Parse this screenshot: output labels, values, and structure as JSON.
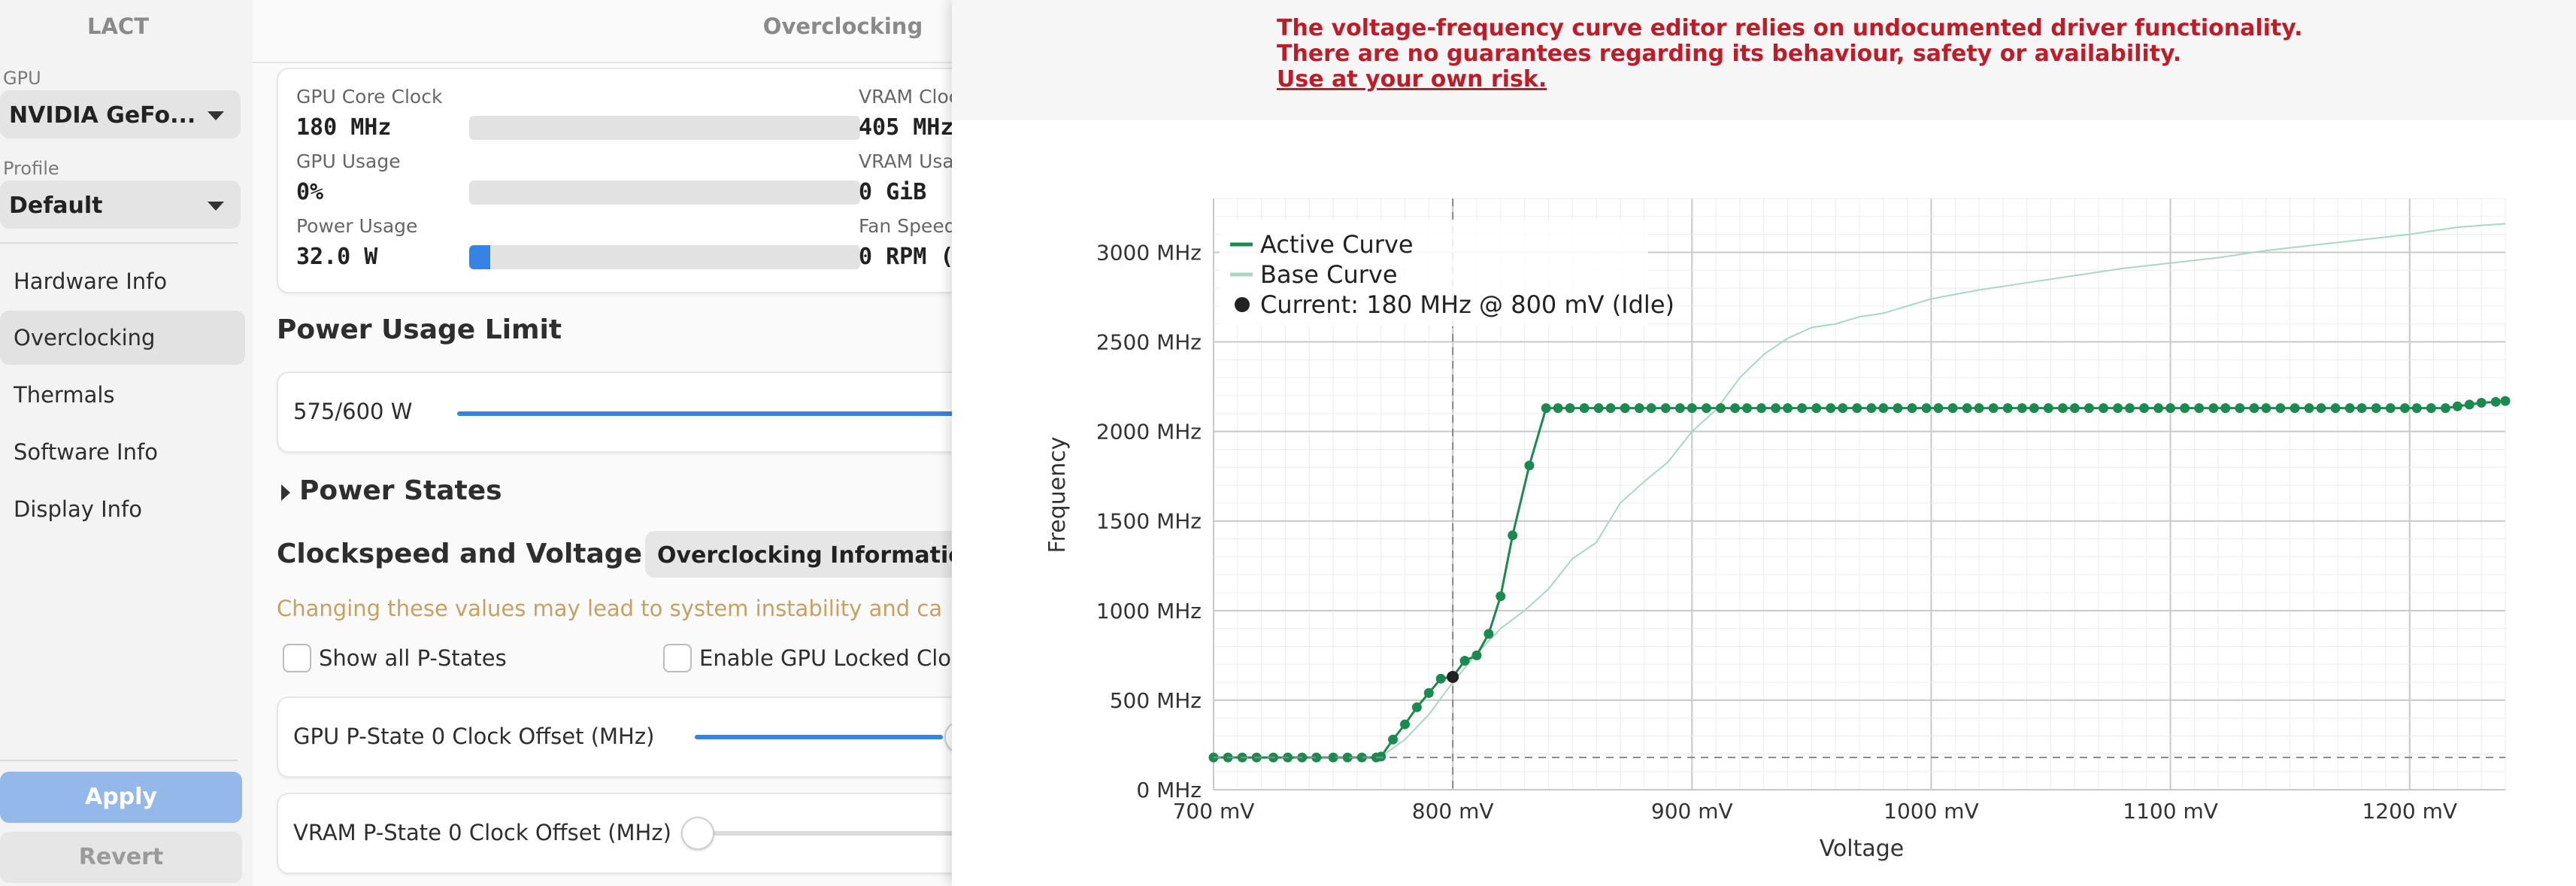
{
  "app": {
    "title": "LACT"
  },
  "sidebar": {
    "gpu_label": "GPU",
    "gpu_value": "NVIDIA GeFo...",
    "profile_label": "Profile",
    "profile_value": "Default",
    "items": [
      {
        "label": "Hardware Info"
      },
      {
        "label": "Overclocking",
        "active": true
      },
      {
        "label": "Thermals"
      },
      {
        "label": "Software Info"
      },
      {
        "label": "Display Info"
      }
    ],
    "apply_label": "Apply",
    "revert_label": "Revert"
  },
  "header": {
    "title": "Overclocking"
  },
  "stats": {
    "gpu_core_clock": {
      "label": "GPU Core Clock",
      "value": "180 MHz",
      "fill": 0.0
    },
    "gpu_usage": {
      "label": "GPU Usage",
      "value": "0%",
      "fill": 0.0
    },
    "power_usage": {
      "label": "Power Usage",
      "value": "32.0 W",
      "fill": 0.053
    },
    "vram_clock": {
      "label": "VRAM Cloc",
      "value": "405 MHz"
    },
    "vram_usage": {
      "label": "VRAM Usa",
      "value": "0 GiB"
    },
    "fan_speed": {
      "label": "Fan Speed",
      "value": "0 RPM ("
    }
  },
  "power_limit": {
    "title": "Power Usage Limit",
    "value": "575/600 W",
    "fraction": 0.958
  },
  "power_states": {
    "title": "Power States"
  },
  "clockspeed": {
    "title": "Clockspeed and Voltage",
    "info_button": "Overclocking Informatio",
    "warning": "Changing these values may lead to system instability and ca",
    "show_all_pstates": "Show all P-States",
    "enable_locked": "Enable GPU Locked Clo",
    "gpu_offset_label": "GPU P-State 0 Clock Offset (MHz)",
    "vram_offset_label": "VRAM P-State 0 Clock Offset (MHz)"
  },
  "vf_editor": {
    "warning_lines": [
      "The voltage-frequency curve editor relies on undocumented driver functionality.",
      "There are no guarantees regarding its behaviour, safety or availability.",
      "Use at your own risk."
    ]
  },
  "chart_data": {
    "type": "line",
    "xlabel": "Voltage",
    "ylabel": "Frequency",
    "xlim": [
      700,
      1240
    ],
    "ylim": [
      0,
      3300
    ],
    "x_ticks": [
      "700 mV",
      "800 mV",
      "900 mV",
      "1000 mV",
      "1100 mV",
      "1200 mV"
    ],
    "y_ticks": [
      "0 MHz",
      "500 MHz",
      "1000 MHz",
      "1500 MHz",
      "2000 MHz",
      "2500 MHz",
      "3000 MHz"
    ],
    "grid": true,
    "legend_position": "top-left",
    "current_point": {
      "x": 800,
      "y": 180,
      "label": "Current: 180 MHz @ 800 mV (Idle)"
    },
    "current_marker_y": 630,
    "colors": {
      "active": "#1b8a4e",
      "base": "#a8d8c0",
      "current": "#222222",
      "grid": "#d6d6d6",
      "dash": "#888888"
    },
    "series": [
      {
        "name": "Active Curve",
        "points": [
          [
            700,
            180
          ],
          [
            706,
            180
          ],
          [
            712,
            180
          ],
          [
            718,
            180
          ],
          [
            725,
            180
          ],
          [
            731,
            180
          ],
          [
            737,
            180
          ],
          [
            743,
            180
          ],
          [
            750,
            180
          ],
          [
            756,
            180
          ],
          [
            762,
            180
          ],
          [
            768,
            180
          ],
          [
            770,
            185
          ],
          [
            775,
            280
          ],
          [
            780,
            365
          ],
          [
            785,
            460
          ],
          [
            790,
            540
          ],
          [
            795,
            620
          ],
          [
            800,
            630
          ],
          [
            805,
            720
          ],
          [
            810,
            750
          ],
          [
            815,
            870
          ],
          [
            820,
            1080
          ],
          [
            825,
            1420
          ],
          [
            832,
            1810
          ],
          [
            839,
            2130
          ],
          [
            844,
            2130
          ],
          [
            849,
            2130
          ],
          [
            855,
            2130
          ],
          [
            861,
            2130
          ],
          [
            866,
            2130
          ],
          [
            872,
            2130
          ],
          [
            878,
            2130
          ],
          [
            883,
            2130
          ],
          [
            889,
            2130
          ],
          [
            895,
            2130
          ],
          [
            900,
            2130
          ],
          [
            906,
            2130
          ],
          [
            912,
            2130
          ],
          [
            918,
            2130
          ],
          [
            923,
            2130
          ],
          [
            929,
            2130
          ],
          [
            935,
            2130
          ],
          [
            940,
            2130
          ],
          [
            946,
            2130
          ],
          [
            952,
            2130
          ],
          [
            958,
            2130
          ],
          [
            963,
            2130
          ],
          [
            969,
            2130
          ],
          [
            975,
            2130
          ],
          [
            980,
            2130
          ],
          [
            986,
            2130
          ],
          [
            992,
            2130
          ],
          [
            998,
            2130
          ],
          [
            1003,
            2130
          ],
          [
            1009,
            2130
          ],
          [
            1015,
            2130
          ],
          [
            1020,
            2130
          ],
          [
            1026,
            2130
          ],
          [
            1032,
            2130
          ],
          [
            1038,
            2130
          ],
          [
            1043,
            2130
          ],
          [
            1049,
            2130
          ],
          [
            1055,
            2130
          ],
          [
            1060,
            2130
          ],
          [
            1066,
            2130
          ],
          [
            1072,
            2130
          ],
          [
            1078,
            2130
          ],
          [
            1083,
            2130
          ],
          [
            1089,
            2130
          ],
          [
            1095,
            2130
          ],
          [
            1100,
            2130
          ],
          [
            1106,
            2130
          ],
          [
            1112,
            2130
          ],
          [
            1118,
            2130
          ],
          [
            1123,
            2130
          ],
          [
            1129,
            2130
          ],
          [
            1135,
            2130
          ],
          [
            1140,
            2130
          ],
          [
            1146,
            2130
          ],
          [
            1152,
            2130
          ],
          [
            1158,
            2130
          ],
          [
            1163,
            2130
          ],
          [
            1169,
            2130
          ],
          [
            1175,
            2130
          ],
          [
            1180,
            2130
          ],
          [
            1186,
            2130
          ],
          [
            1192,
            2130
          ],
          [
            1198,
            2130
          ],
          [
            1203,
            2130
          ],
          [
            1209,
            2130
          ],
          [
            1215,
            2130
          ],
          [
            1220,
            2140
          ],
          [
            1225,
            2150
          ],
          [
            1230,
            2160
          ],
          [
            1236,
            2165
          ],
          [
            1240,
            2170
          ]
        ]
      },
      {
        "name": "Base Curve",
        "points": [
          [
            770,
            185
          ],
          [
            780,
            280
          ],
          [
            790,
            420
          ],
          [
            800,
            600
          ],
          [
            810,
            760
          ],
          [
            820,
            900
          ],
          [
            830,
            1000
          ],
          [
            840,
            1120
          ],
          [
            850,
            1290
          ],
          [
            860,
            1380
          ],
          [
            870,
            1600
          ],
          [
            880,
            1720
          ],
          [
            890,
            1830
          ],
          [
            900,
            2000
          ],
          [
            910,
            2120
          ],
          [
            920,
            2300
          ],
          [
            930,
            2430
          ],
          [
            940,
            2520
          ],
          [
            950,
            2580
          ],
          [
            960,
            2600
          ],
          [
            970,
            2640
          ],
          [
            980,
            2660
          ],
          [
            990,
            2700
          ],
          [
            1000,
            2740
          ],
          [
            1020,
            2790
          ],
          [
            1040,
            2830
          ],
          [
            1060,
            2870
          ],
          [
            1080,
            2910
          ],
          [
            1100,
            2940
          ],
          [
            1120,
            2970
          ],
          [
            1140,
            3010
          ],
          [
            1160,
            3040
          ],
          [
            1180,
            3070
          ],
          [
            1200,
            3100
          ],
          [
            1220,
            3140
          ],
          [
            1240,
            3160
          ]
        ]
      }
    ]
  }
}
